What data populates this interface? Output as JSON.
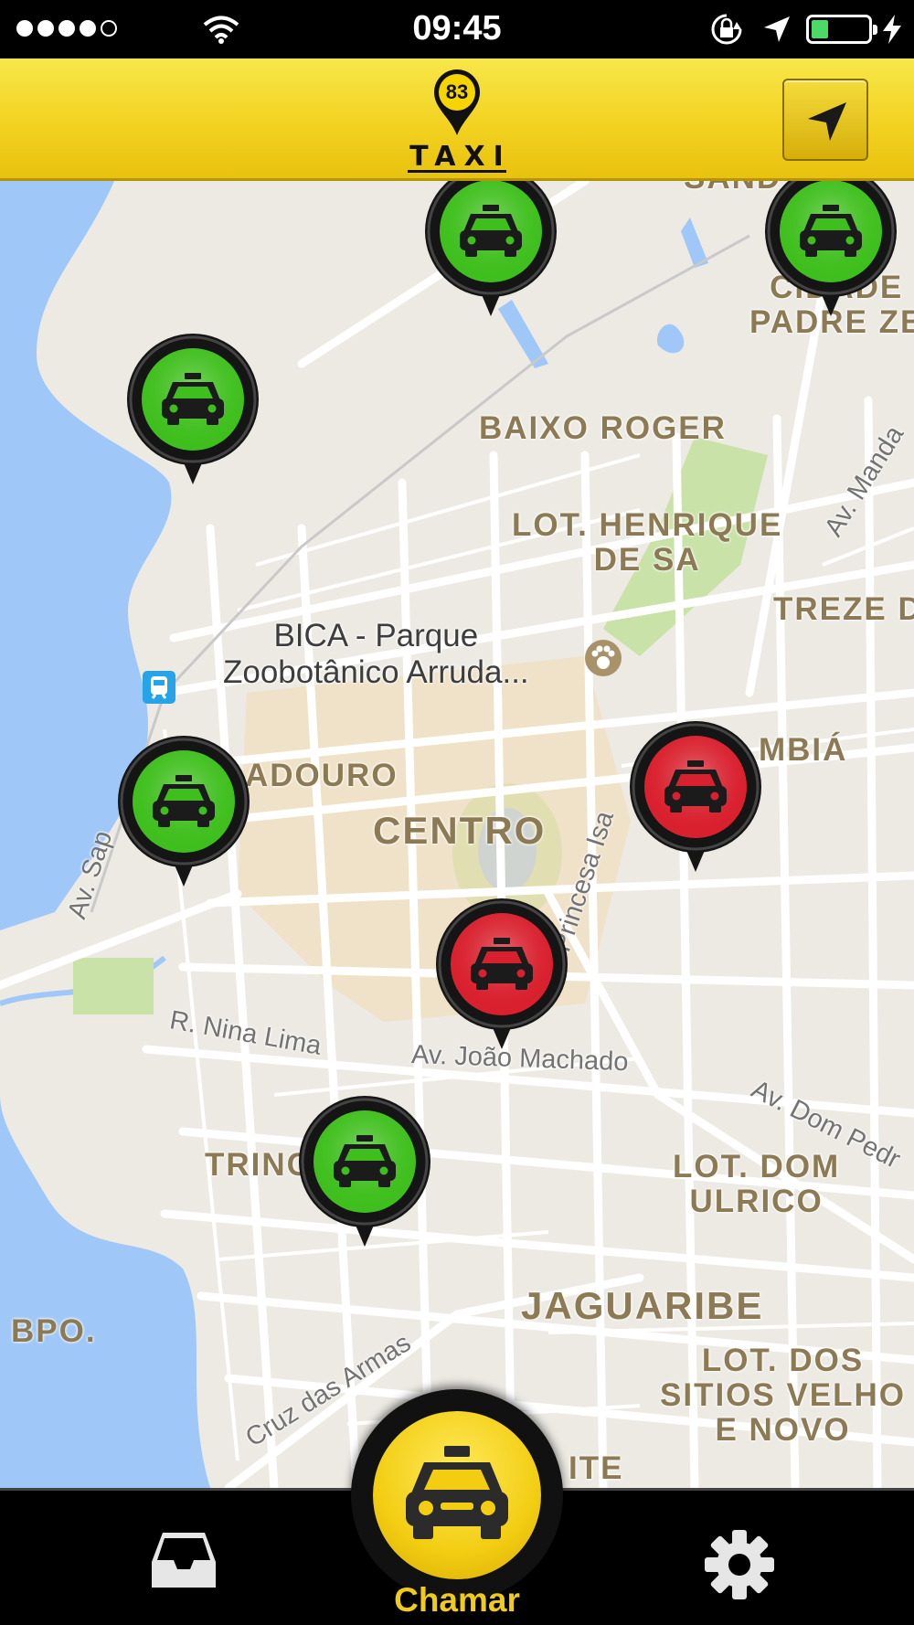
{
  "status_bar": {
    "time": "09:45",
    "battery_level": 0.3,
    "signal_bars_filled": 4,
    "signal_bars_total": 5
  },
  "header": {
    "logo_number": "83",
    "logo_text": "TAXI",
    "locate_icon": "navigation-arrow-icon"
  },
  "map": {
    "labels": {
      "cidade_padre": "CIDADE\nPADRE ZE",
      "baixo_roger": "BAIXO ROGER",
      "lot_henrique": "LOT. HENRIQUE\nDE SA",
      "treze": "TREZE D",
      "adouro": "ADOURO",
      "centro": "CENTRO",
      "mbia": "MBIÁ",
      "trinc": "TRINC",
      "lot_dom": "LOT. DOM\nULRICO",
      "jaguaribe": "JAGUARIBE",
      "lot_dos": "LOT. DOS\nSITIOS VELHO\nE NOVO",
      "bpo": "BPO.",
      "ite": "ITE",
      "sand": "SAND"
    },
    "poi": "BICA - Parque\nZoobotânico Arruda...",
    "streets": {
      "nina_lima": "R. Nina Lima",
      "joao_machado": "Av. João Machado",
      "dom_pedro": "Av. Dom Pedr",
      "princesa": "Princesa Isa",
      "cruz_armas": "Cruz das Armas",
      "sap": "Av. Sap",
      "manda": "Av. Manda"
    },
    "taxis": [
      {
        "status": "available",
        "color": "#3fbf1d"
      },
      {
        "status": "available",
        "color": "#3fbf1d"
      },
      {
        "status": "available",
        "color": "#3fbf1d"
      },
      {
        "status": "available",
        "color": "#3fbf1d"
      },
      {
        "status": "occupied",
        "color": "#d9202e"
      },
      {
        "status": "occupied",
        "color": "#d9202e"
      },
      {
        "status": "available",
        "color": "#3fbf1d"
      }
    ]
  },
  "tabbar": {
    "inbox_icon": "inbox-tray-icon",
    "call_label": "Chamar",
    "settings_icon": "gear-icon"
  },
  "colors": {
    "header_yellow": "#f3d221",
    "call_label": "#f1cb1a",
    "water": "#9fc7f7"
  }
}
